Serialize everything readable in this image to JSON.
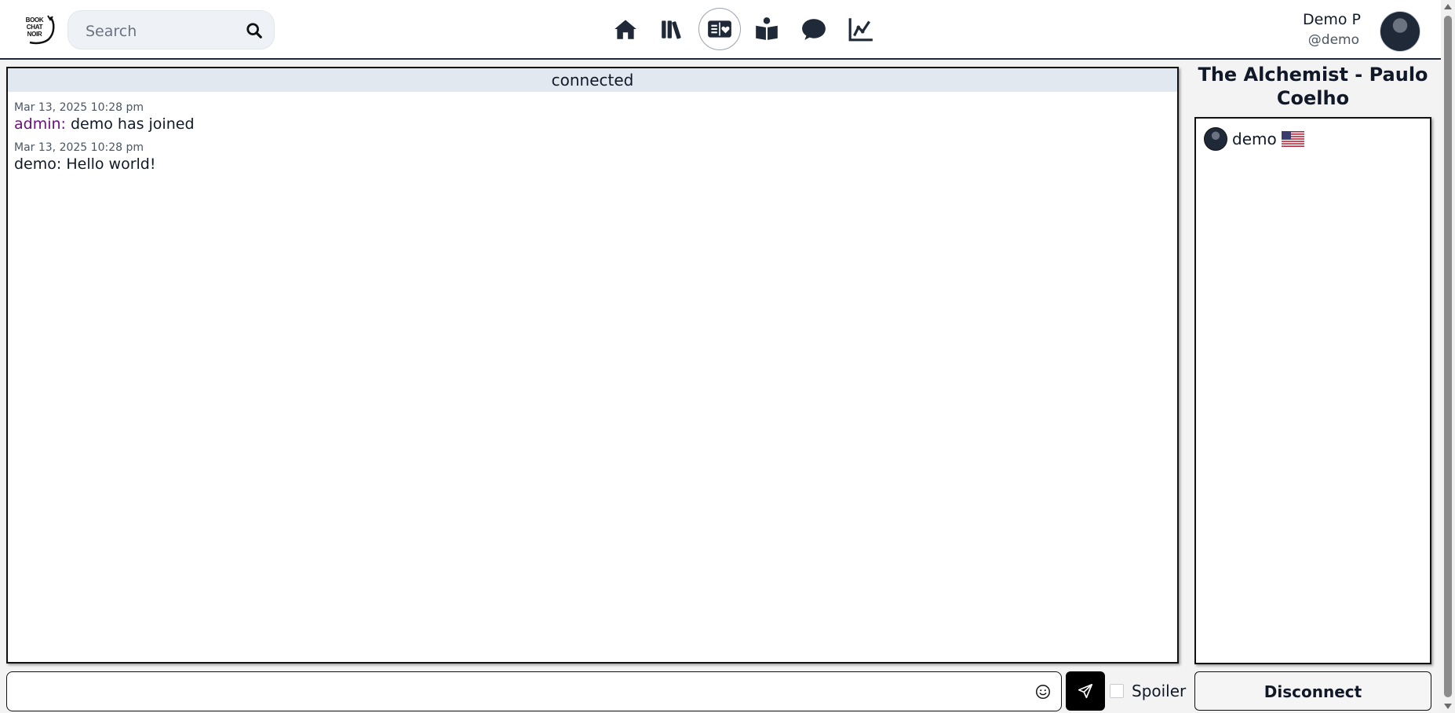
{
  "app": {
    "logo_text": "BOOK CHAT NOIR",
    "accent_color": "#000000",
    "admin_color": "#6b0f82"
  },
  "search": {
    "placeholder": "Search",
    "icon": "search-icon"
  },
  "nav": {
    "items": [
      {
        "name": "home",
        "icon": "home-icon",
        "active": false
      },
      {
        "name": "library",
        "icon": "books-icon",
        "active": false
      },
      {
        "name": "book-chat",
        "icon": "book-heart-icon",
        "active": true
      },
      {
        "name": "reading",
        "icon": "reader-icon",
        "active": false
      },
      {
        "name": "chat",
        "icon": "chat-bubble-icon",
        "active": false
      },
      {
        "name": "stats",
        "icon": "line-chart-icon",
        "active": false
      }
    ]
  },
  "user": {
    "name": "Demo P",
    "handle": "@demo"
  },
  "chat": {
    "status": "connected",
    "messages": [
      {
        "time": "Mar 13, 2025 10:28 pm",
        "author": "admin:",
        "text": "demo has joined"
      },
      {
        "time": "Mar 13, 2025 10:28 pm",
        "author": "demo:",
        "text": "Hello world!"
      }
    ]
  },
  "room": {
    "title": "The Alchemist - Paulo Coelho",
    "members": [
      {
        "name": "demo",
        "flag": "us-flag-icon"
      }
    ]
  },
  "composer": {
    "value": "",
    "emoji_icon": "emoji-icon",
    "send_icon": "send-icon",
    "spoiler_label": "Spoiler",
    "spoiler_checked": false
  },
  "actions": {
    "disconnect_label": "Disconnect"
  }
}
